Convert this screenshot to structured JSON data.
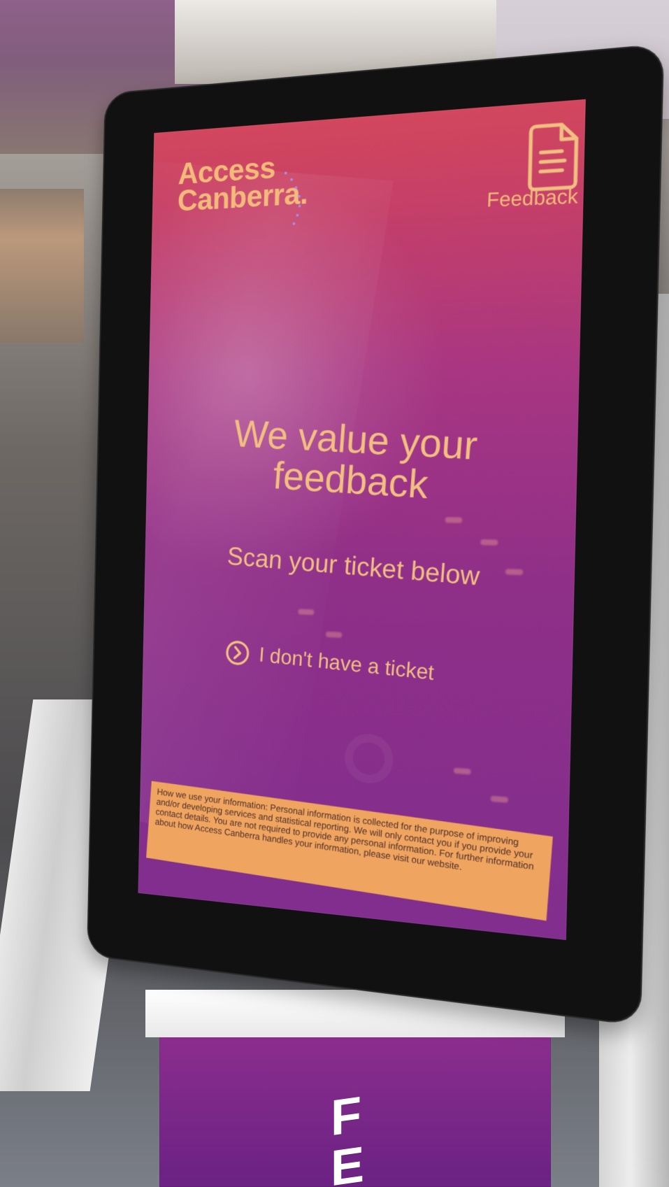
{
  "brand": {
    "line1": "Access",
    "line2": "Canberra."
  },
  "screen": {
    "feedback_label": "Feedback",
    "headline_line1": "We value your",
    "headline_line2": "feedback",
    "subheadline": "Scan your ticket below",
    "no_ticket_label": "I don't have a ticket",
    "privacy_text": "How we use your information: Personal information is collected for the purpose of improving and/or developing services and statistical reporting. We will only contact you if you provide your contact details. You are not required to provide any personal information. For further information about how Access Canberra handles your information, please visit our website."
  },
  "stand": {
    "letters_line1": "F",
    "letters_line2": "E"
  },
  "icons": {
    "feedback": "document-icon",
    "no_ticket": "chevron-right-circle-icon"
  },
  "colors": {
    "screen_top": "#d2475d",
    "screen_bottom": "#812e8e",
    "accent_text": "#f1bf82",
    "privacy_box": "#efa45f"
  }
}
